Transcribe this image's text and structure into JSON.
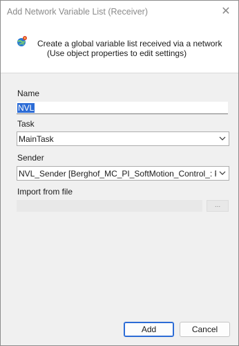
{
  "window": {
    "title": "Add Network Variable List (Receiver)",
    "close_glyph": "✕"
  },
  "header": {
    "icon": "network-globe-icon",
    "line1": "Create a global variable list received via a network",
    "line2": "(Use object properties to edit settings)"
  },
  "form": {
    "name_label": "Name",
    "name_value": "NVL",
    "task_label": "Task",
    "task_value": "MainTask",
    "sender_label": "Sender",
    "sender_value": "NVL_Sender [Berghof_MC_PI_SoftMotion_Control_: PLC Logic: Application]",
    "import_label": "Import from file",
    "import_value": "",
    "browse_label": "..."
  },
  "buttons": {
    "add": "Add",
    "cancel": "Cancel"
  },
  "colors": {
    "selection": "#2c6cd6",
    "title_text": "#8a8a8a"
  }
}
